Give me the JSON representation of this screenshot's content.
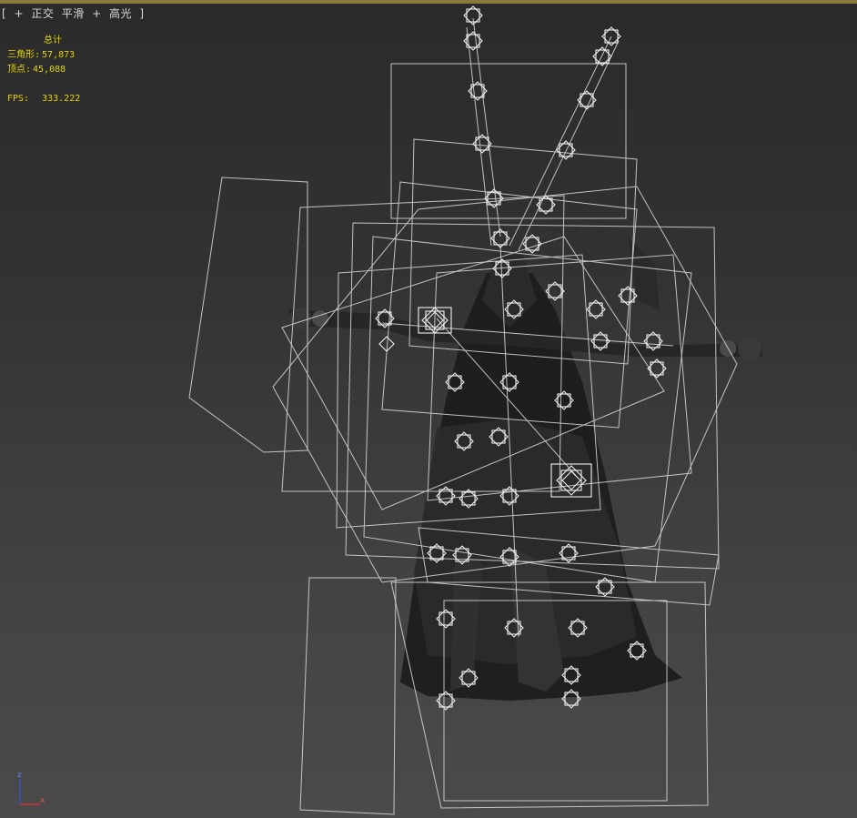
{
  "viewport": {
    "label": {
      "open": "[",
      "plus1": "+",
      "view": "正交",
      "shading": "平滑",
      "plus2": "+",
      "highlight": "高光",
      "close": "]"
    },
    "stats": {
      "heading": "总计",
      "triangles_label": "三角形:",
      "triangles_value": "57,873",
      "vertices_label": "顶点:",
      "vertices_value": "45,088",
      "fps_label": "FPS:",
      "fps_value": "333.222"
    },
    "axis": {
      "x": "x",
      "z": "z"
    },
    "colors": {
      "bg_top": "#2a2a2a",
      "bg_bottom": "#4a4a4a",
      "stats_text": "#e6d200",
      "wire": "#dcdcdc",
      "axis_x": "#d03030",
      "axis_z": "#3050d0",
      "top_border": "#8a7a3a"
    }
  }
}
